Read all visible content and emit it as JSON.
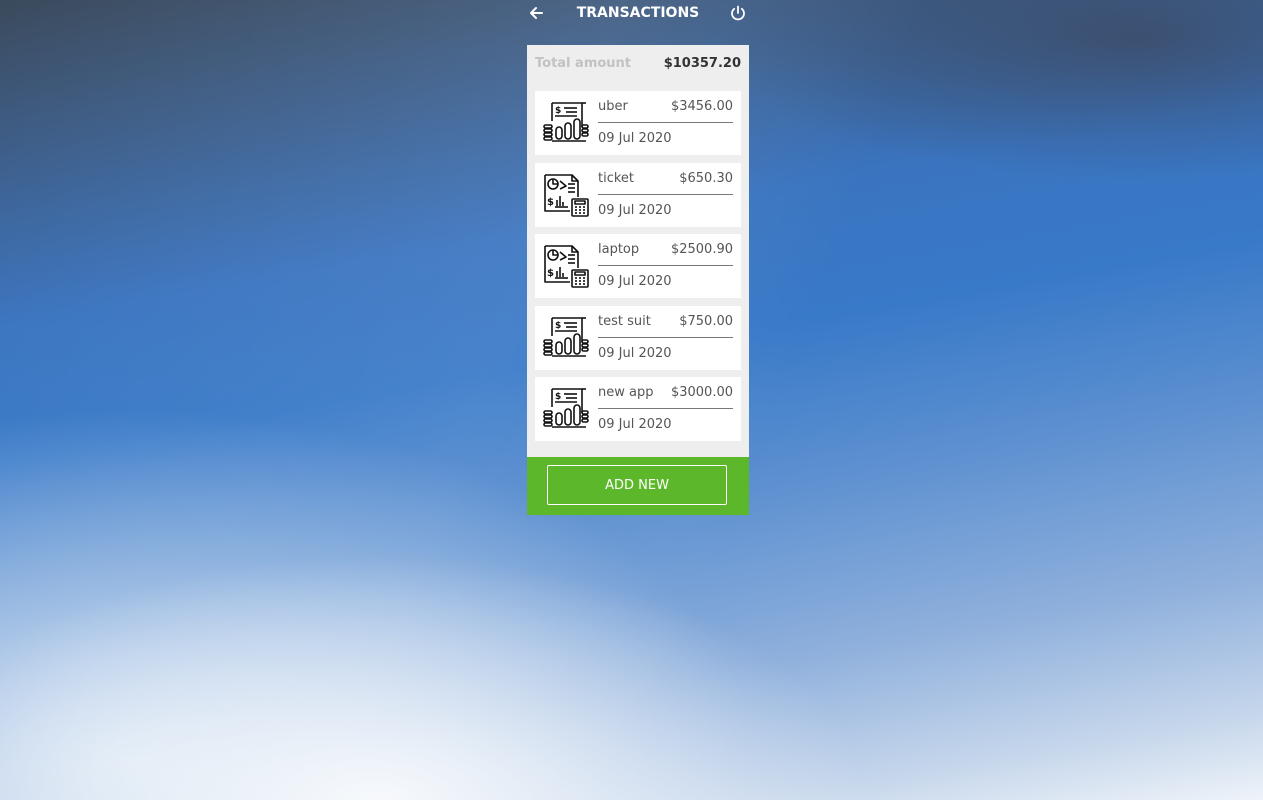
{
  "header": {
    "title": "TRANSACTIONS",
    "back_icon": "arrow-left-icon",
    "power_icon": "power-icon"
  },
  "summary": {
    "total_label": "Total amount",
    "total_value": "$10357.20"
  },
  "transactions": [
    {
      "name": "uber",
      "amount": "$3456.00",
      "date": "09 Jul 2020",
      "icon": "invoice-chart-icon"
    },
    {
      "name": "ticket",
      "amount": "$650.30",
      "date": "09 Jul 2020",
      "icon": "report-calculator-icon"
    },
    {
      "name": "laptop",
      "amount": "$2500.90",
      "date": "09 Jul 2020",
      "icon": "report-calculator-icon"
    },
    {
      "name": "test suit",
      "amount": "$750.00",
      "date": "09 Jul 2020",
      "icon": "invoice-chart-icon"
    },
    {
      "name": "new app",
      "amount": "$3000.00",
      "date": "09 Jul 2020",
      "icon": "invoice-chart-icon"
    }
  ],
  "footer": {
    "add_label": "ADD NEW"
  },
  "colors": {
    "accent_green": "#5cb82a",
    "panel_bg": "#eeeeee",
    "card_bg": "#ffffff",
    "muted_label": "#c2c2c2",
    "text": "#555555"
  }
}
